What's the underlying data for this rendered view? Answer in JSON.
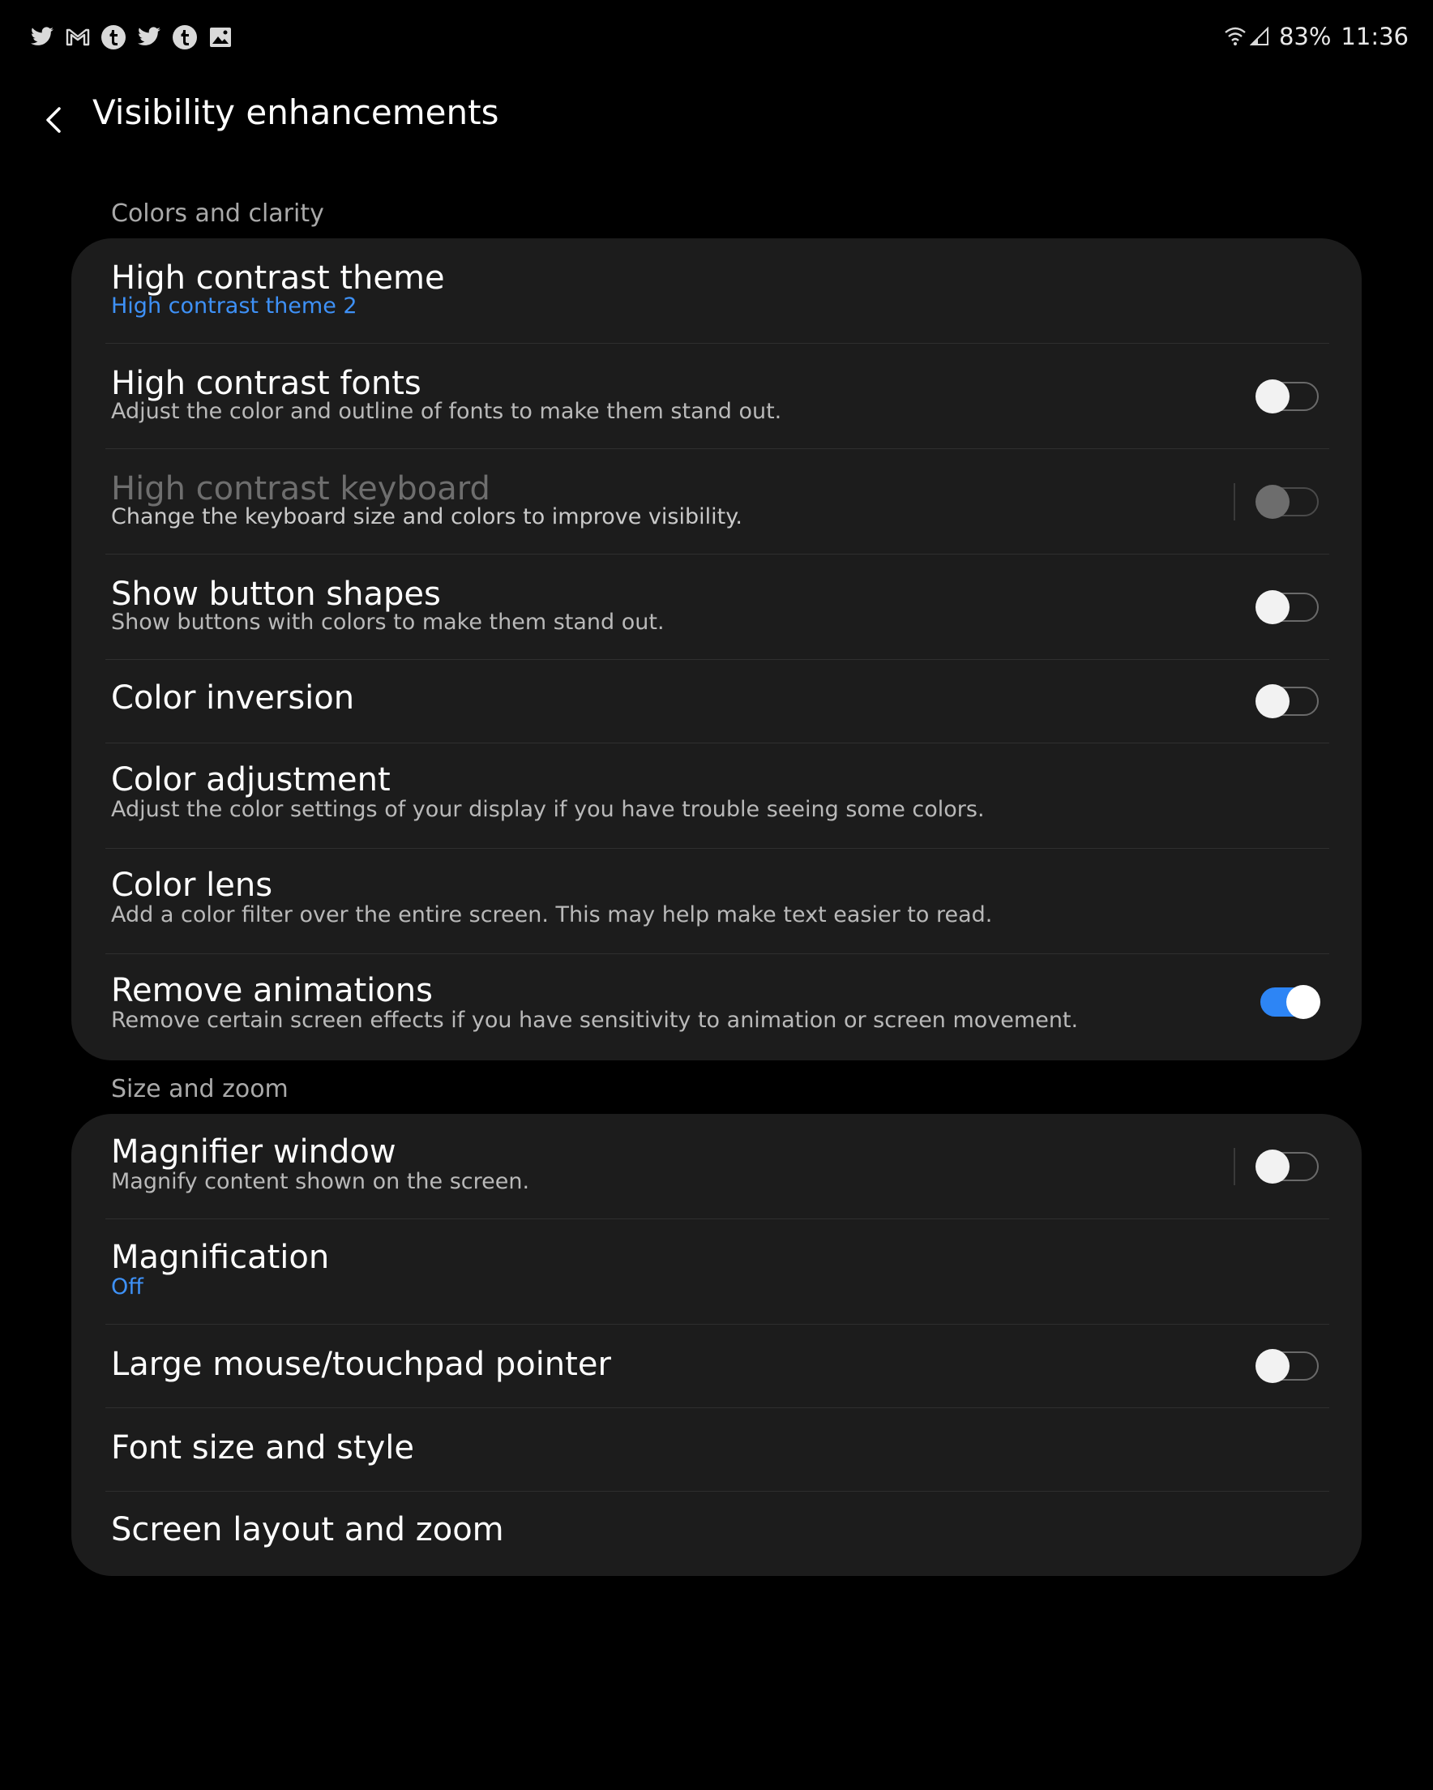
{
  "status_bar": {
    "notification_icons": [
      "twitter-icon",
      "gmail-icon",
      "tumblr-icon",
      "twitter-icon",
      "tumblr-icon",
      "image-icon"
    ],
    "battery": "83%",
    "time": "11:36"
  },
  "header": {
    "title": "Visibility enhancements"
  },
  "sections": {
    "colors": {
      "header": "Colors and clarity",
      "items": [
        {
          "title": "High contrast theme",
          "subtitle": "High contrast theme 2"
        },
        {
          "title": "High contrast fonts",
          "subtitle": "Adjust the color and outline of fonts to make them stand out.",
          "toggle": false
        },
        {
          "title": "High contrast keyboard",
          "subtitle": "Change the keyboard size and colors to improve visibility.",
          "toggle": false,
          "disabled": true
        },
        {
          "title": "Show button shapes",
          "subtitle": "Show buttons with colors to make them stand out.",
          "toggle": false
        },
        {
          "title": "Color inversion",
          "toggle": false
        },
        {
          "title": "Color adjustment",
          "subtitle": "Adjust the color settings of your display if you have trouble seeing some colors."
        },
        {
          "title": "Color lens",
          "subtitle": "Add a color filter over the entire screen. This may help make text easier to read."
        },
        {
          "title": "Remove animations",
          "subtitle": "Remove certain screen effects if you have sensitivity to animation or screen movement.",
          "toggle": true
        }
      ]
    },
    "size": {
      "header": "Size and zoom",
      "items": [
        {
          "title": "Magnifier window",
          "subtitle": "Magnify content shown on the screen.",
          "toggle": false
        },
        {
          "title": "Magnification",
          "subtitle": "Off"
        },
        {
          "title": "Large mouse/touchpad pointer",
          "toggle": false
        },
        {
          "title": "Font size and style"
        },
        {
          "title": "Screen layout and zoom"
        }
      ]
    }
  },
  "colors": {
    "background": "#000000",
    "card": "#1c1c1c",
    "accent": "#3e91f7",
    "toggle_on": "#2d85f5"
  }
}
